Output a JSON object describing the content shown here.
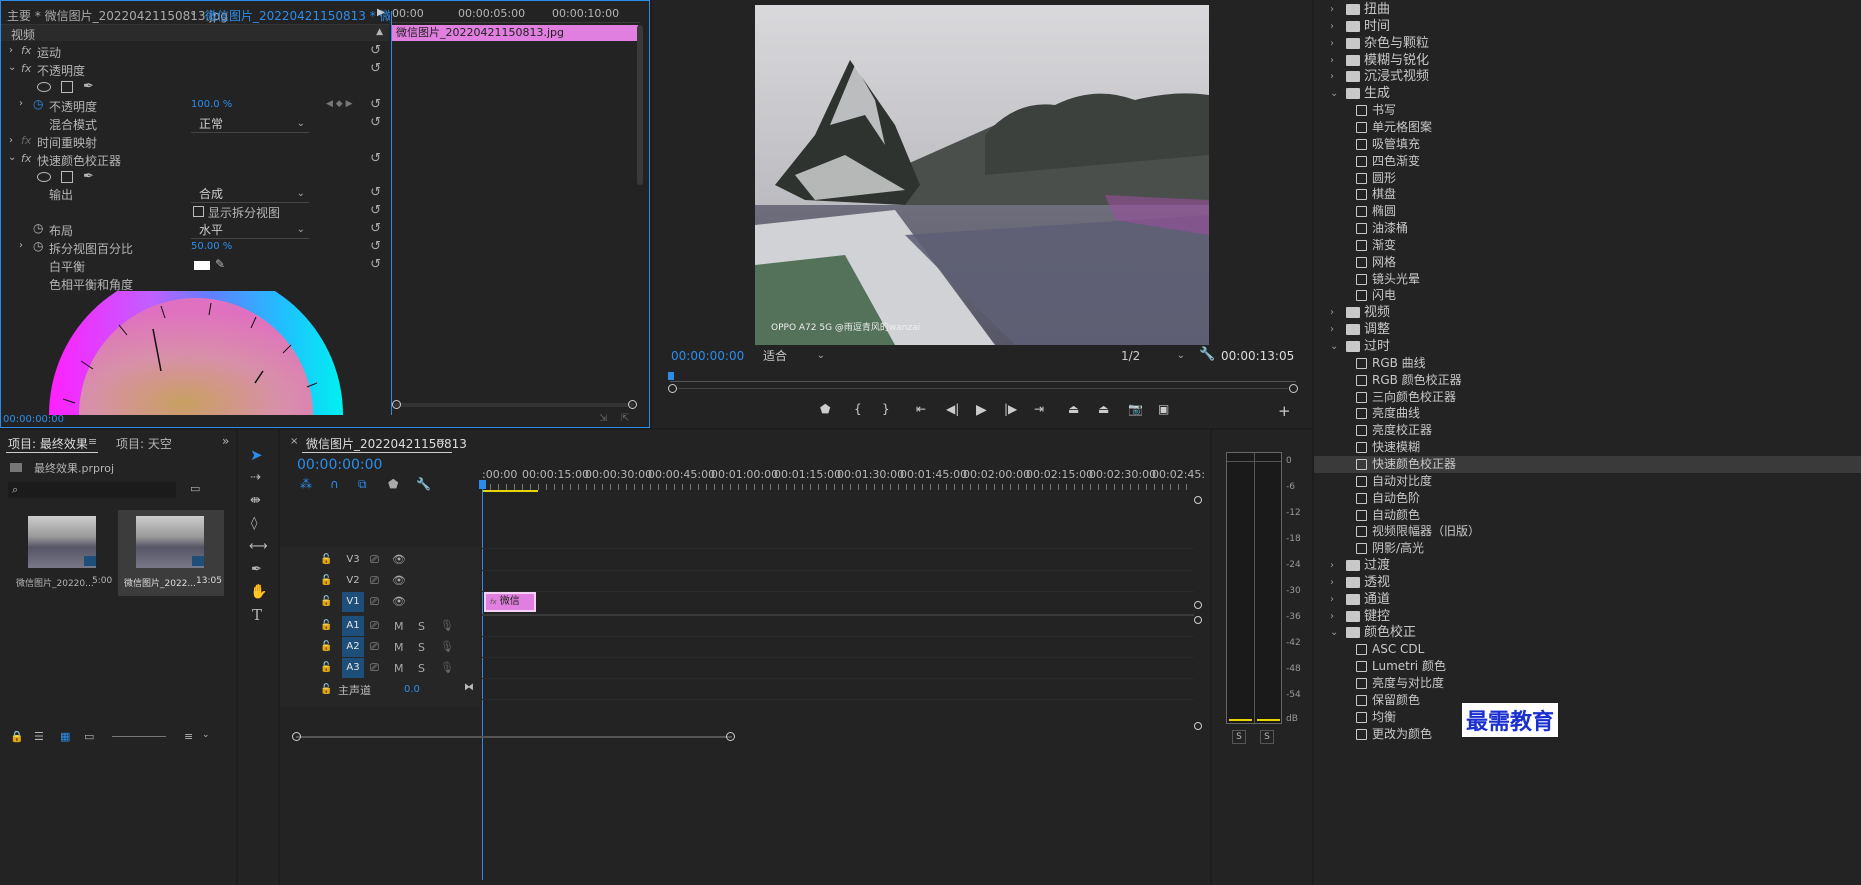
{
  "effect_controls": {
    "tab_main": "主要 * 微信图片_20220421150813.jpg",
    "tab_seq": "微信图片_20220421150813 * 微...",
    "section": "视频",
    "motion": "运动",
    "opacity_group": "不透明度",
    "opacity_label": "不透明度",
    "opacity_value": "100.0 %",
    "blend_label": "混合模式",
    "blend_value": "正常",
    "time_remap": "时间重映射",
    "qcc": "快速颜色校正器",
    "output_label": "输出",
    "output_value": "合成",
    "split_view_label": "显示拆分视图",
    "layout_label": "布局",
    "layout_value": "水平",
    "split_pct_label": "拆分视图百分比",
    "split_pct_value": "50.00 %",
    "wb_label": "白平衡",
    "hue_label": "色相平衡和角度",
    "timecode": "00:00:00:00",
    "mini_ruler": [
      "00:00",
      "00:00:05:00",
      "00:00:10:00"
    ],
    "clip_name": "微信图片_20220421150813.jpg"
  },
  "program_monitor": {
    "watermark_text": "OPPO A72 5G  @雨逗青风的wanzai",
    "timecode": "00:00:00:00",
    "fit_value": "适合",
    "res_value": "1/2",
    "duration": "00:00:13:05"
  },
  "project": {
    "tab1": "项目: 最终效果",
    "tab2": "项目: 天空",
    "file": "最终效果.prproj",
    "items": [
      {
        "name": "微信图片_20220...",
        "duration": "5:00"
      },
      {
        "name": "微信图片_2022...",
        "duration": "13:05"
      }
    ]
  },
  "timeline": {
    "tab": "微信图片_20220421150813",
    "timecode": "00:00:00:00",
    "ruler": [
      ":00:00",
      "00:00:15:00",
      "00:00:30:00",
      "00:00:45:00",
      "00:01:00:00",
      "00:01:15:00",
      "00:01:30:00",
      "00:01:45:00",
      "00:02:00:00",
      "00:02:15:00",
      "00:02:30:00",
      "00:02:45:"
    ],
    "video_tracks": [
      "V3",
      "V2",
      "V1"
    ],
    "audio_tracks": [
      "A1",
      "A2",
      "A3"
    ],
    "master_label": "主声道",
    "master_value": "0.0",
    "clip_label": "微信",
    "clip_fx": "fx",
    "m": "M",
    "s": "S"
  },
  "meter": {
    "scale": [
      "0",
      "-6",
      "-12",
      "-18",
      "-24",
      "-30",
      "-36",
      "-42",
      "-48",
      "-54",
      "dB"
    ],
    "solo_l": "S",
    "solo_r": "S"
  },
  "effects_tree": [
    {
      "level": 0,
      "open": false,
      "label": "扭曲"
    },
    {
      "level": 0,
      "open": false,
      "label": "时间"
    },
    {
      "level": 0,
      "open": false,
      "label": "杂色与颗粒"
    },
    {
      "level": 0,
      "open": false,
      "label": "模糊与锐化"
    },
    {
      "level": 0,
      "open": false,
      "label": "沉浸式视频"
    },
    {
      "level": 0,
      "open": true,
      "label": "生成"
    },
    {
      "level": 1,
      "label": "书写"
    },
    {
      "level": 1,
      "label": "单元格图案"
    },
    {
      "level": 1,
      "label": "吸管填充"
    },
    {
      "level": 1,
      "label": "四色渐变"
    },
    {
      "level": 1,
      "label": "圆形"
    },
    {
      "level": 1,
      "label": "棋盘"
    },
    {
      "level": 1,
      "label": "椭圆"
    },
    {
      "level": 1,
      "label": "油漆桶"
    },
    {
      "level": 1,
      "label": "渐变"
    },
    {
      "level": 1,
      "label": "网格"
    },
    {
      "level": 1,
      "label": "镜头光晕"
    },
    {
      "level": 1,
      "label": "闪电"
    },
    {
      "level": 0,
      "open": false,
      "label": "视频"
    },
    {
      "level": 0,
      "open": false,
      "label": "调整"
    },
    {
      "level": 0,
      "open": true,
      "label": "过时"
    },
    {
      "level": 1,
      "label": "RGB 曲线"
    },
    {
      "level": 1,
      "label": "RGB 颜色校正器"
    },
    {
      "level": 1,
      "label": "三向颜色校正器"
    },
    {
      "level": 1,
      "label": "亮度曲线"
    },
    {
      "level": 1,
      "label": "亮度校正器"
    },
    {
      "level": 1,
      "label": "快速模糊"
    },
    {
      "level": 1,
      "label": "快速颜色校正器",
      "selected": true
    },
    {
      "level": 1,
      "label": "自动对比度"
    },
    {
      "level": 1,
      "label": "自动色阶"
    },
    {
      "level": 1,
      "label": "自动颜色"
    },
    {
      "level": 1,
      "label": "视频限幅器（旧版）"
    },
    {
      "level": 1,
      "label": "阴影/高光"
    },
    {
      "level": 0,
      "open": false,
      "label": "过渡"
    },
    {
      "level": 0,
      "open": false,
      "label": "透视"
    },
    {
      "level": 0,
      "open": false,
      "label": "通道"
    },
    {
      "level": 0,
      "open": false,
      "label": "键控"
    },
    {
      "level": 0,
      "open": true,
      "label": "颜色校正"
    },
    {
      "level": 1,
      "label": "ASC CDL"
    },
    {
      "level": 1,
      "label": "Lumetri 颜色"
    },
    {
      "level": 1,
      "label": "亮度与对比度"
    },
    {
      "level": 1,
      "label": "保留颜色"
    },
    {
      "level": 1,
      "label": "均衡"
    },
    {
      "level": 1,
      "label": "更改为颜色"
    }
  ],
  "brand": "最需教育",
  "colors": {
    "accent": "#2d8ceb",
    "clip": "#e07fdf",
    "panel": "#232323",
    "selected": "#3a3a3a"
  }
}
